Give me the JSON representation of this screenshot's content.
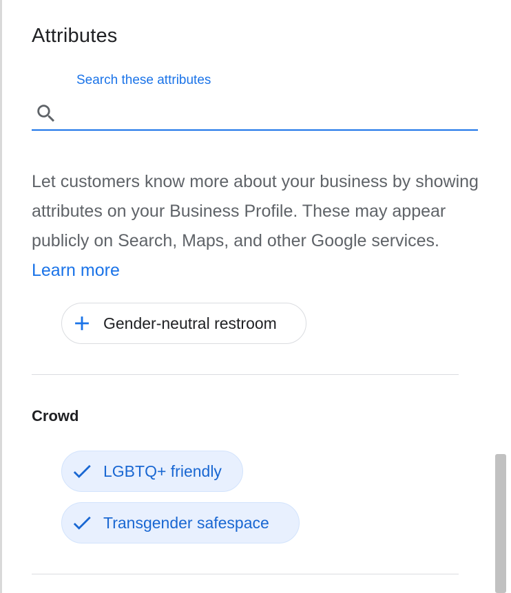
{
  "dialog": {
    "title": "Attributes"
  },
  "search": {
    "label": "Search these attributes",
    "value": "",
    "icon": "search-icon"
  },
  "description": {
    "text": "Let customers know more about your business by showing attributes on your Business Profile. These may appear publicly on Search, Maps, and other Google services.",
    "link_label": "Learn more"
  },
  "unselected_attributes": [
    {
      "label": "Gender-neutral restroom",
      "icon": "plus-icon"
    }
  ],
  "crowd": {
    "title": "Crowd",
    "attributes": [
      {
        "label": "LGBTQ+ friendly",
        "icon": "check-icon",
        "selected": true
      },
      {
        "label": "Transgender safespace",
        "icon": "check-icon",
        "selected": true
      }
    ]
  },
  "colors": {
    "accent": "#1a73e8",
    "selected_chip_bg": "#e8f0fe",
    "text_secondary": "#5f6368"
  }
}
